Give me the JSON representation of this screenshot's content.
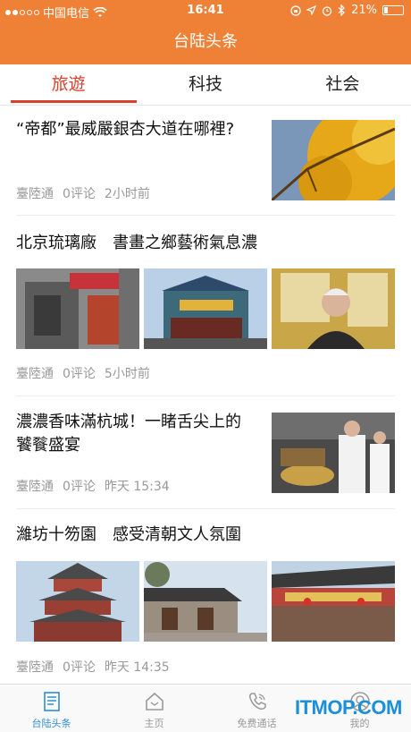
{
  "status_bar": {
    "carrier": "中国电信",
    "time": "16:41",
    "battery": "21%",
    "battery_level": 0.21
  },
  "header": {
    "title": "台陆头条"
  },
  "tabs": [
    {
      "label": "旅遊",
      "active": true
    },
    {
      "label": "科技",
      "active": false
    },
    {
      "label": "社会",
      "active": false
    }
  ],
  "articles": [
    {
      "title": "“帝都”最威嚴銀杏大道在哪裡?",
      "source": "臺陸通",
      "comments": "0评论",
      "time": "2小时前"
    },
    {
      "title": "北京琉璃廠　書畫之鄉藝術氣息濃",
      "source": "臺陸通",
      "comments": "0评论",
      "time": "5小时前"
    },
    {
      "title": "濃濃香味滿杭城！一睹舌尖上的饕餮盛宴",
      "source": "臺陸通",
      "comments": "0评论",
      "time": "昨天 15:34"
    },
    {
      "title": "濰坊十笏園　感受清朝文人氛圍",
      "source": "臺陸通",
      "comments": "0评论",
      "time": "昨天 14:35"
    }
  ],
  "tab_bar": [
    {
      "label": "台陆头条",
      "icon": "news-icon",
      "active": true
    },
    {
      "label": "主页",
      "icon": "home-icon",
      "active": false
    },
    {
      "label": "免费通话",
      "icon": "phone-icon",
      "active": false
    },
    {
      "label": "我的",
      "icon": "user-icon",
      "active": false
    }
  ],
  "watermark": "ITMOP.COM",
  "colors": {
    "brand": "#ef8137",
    "active_tab": "#d9412f",
    "tabbar_active": "#2e8fd6"
  }
}
